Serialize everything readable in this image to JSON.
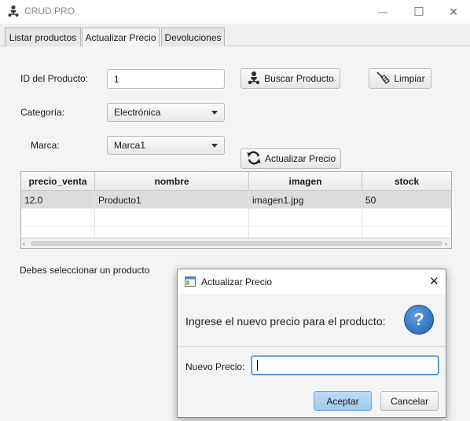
{
  "window": {
    "title": "CRUD PRO",
    "minimize_glyph": "—",
    "maximize_glyph": "☐",
    "close_glyph": "✕"
  },
  "tabs": [
    {
      "label": "Listar productos"
    },
    {
      "label": "Actualizar Precio"
    },
    {
      "label": "Devoluciones"
    }
  ],
  "form": {
    "id_label": "ID del Producto:",
    "id_value": "1",
    "search_label": "Buscar Producto",
    "clear_label": "Limpiar",
    "category_label": "Categoría:",
    "category_value": "Electrónica",
    "brand_label": "Marca:",
    "brand_value": "Marca1",
    "update_label": "Actualizar Precio"
  },
  "table": {
    "columns": [
      "precio_venta",
      "nombre",
      "imagen",
      "stock"
    ],
    "rows": [
      [
        "12.0",
        "Producto1",
        "imagen1.jpg",
        "50"
      ]
    ]
  },
  "status_message": "Debes seleccionar un producto",
  "dialog": {
    "title": "Actualizar Precio",
    "header_text": "Ingrese el nuevo precio para el producto:",
    "question_glyph": "?",
    "field_label": "Nuevo Precio:",
    "field_value": "",
    "ok_label": "Aceptar",
    "cancel_label": "Cancelar",
    "close_glyph": "✕"
  },
  "colors": {
    "accent": "#2f7cd0",
    "selected_row": "#dcdcdc",
    "ok_button": "#a8cff0"
  }
}
